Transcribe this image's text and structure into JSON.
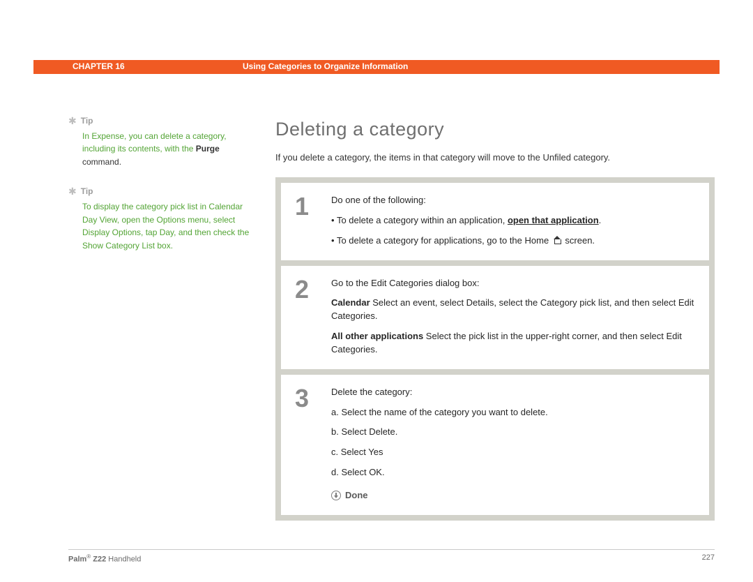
{
  "header": {
    "chapter_label": "CHAPTER 16",
    "topic": "Using Categories to Organize Information"
  },
  "sidebar": {
    "tips": [
      {
        "label": "Tip",
        "lines": [
          {
            "kind": "green",
            "text": "In Expense, you can delete a category, including its contents, with the "
          },
          {
            "kind": "black_bold",
            "text": "Purge"
          },
          {
            "kind": "black",
            "text": " command."
          }
        ]
      },
      {
        "label": "Tip",
        "lines": [
          {
            "kind": "green",
            "text": "To display the category pick list in Calendar Day View, open the Options menu, select Display Options, tap Day, and then check the Show Category List box."
          }
        ]
      }
    ]
  },
  "main": {
    "title": "Deleting a category",
    "intro": "If you delete a category, the items in that category will move to the Unfiled category.",
    "steps": [
      {
        "num": "1",
        "blocks": [
          {
            "type": "p",
            "text": "Do one of the following:"
          },
          {
            "type": "bullet",
            "parts": [
              {
                "kind": "plain",
                "text": "To delete a category within an application, "
              },
              {
                "kind": "bold_underline",
                "text": "open that application"
              },
              {
                "kind": "plain",
                "text": "."
              }
            ]
          },
          {
            "type": "bullet_home",
            "before": "To delete a category for applications, go to the Home ",
            "after": " screen."
          }
        ]
      },
      {
        "num": "2",
        "blocks": [
          {
            "type": "p",
            "text": "Go to the Edit Categories dialog box:"
          },
          {
            "type": "lead",
            "lead": "Calendar",
            "rest": "    Select an event, select Details, select the Category pick list, and then select Edit Categories."
          },
          {
            "type": "lead",
            "lead": "All other applications",
            "rest": "    Select the pick list in the upper-right corner, and then select Edit Categories."
          }
        ]
      },
      {
        "num": "3",
        "blocks": [
          {
            "type": "p",
            "text": "Delete the category:"
          },
          {
            "type": "p",
            "text": "a.  Select the name of the category you want to delete."
          },
          {
            "type": "p",
            "text": "b.  Select Delete."
          },
          {
            "type": "p",
            "text": "c.  Select Yes"
          },
          {
            "type": "p",
            "text": "d.  Select OK."
          },
          {
            "type": "done",
            "text": "Done"
          }
        ]
      }
    ]
  },
  "footer": {
    "brand_bold": "Palm",
    "brand_reg": "®",
    "brand_model": " Z22",
    "brand_suffix": " Handheld",
    "page_number": "227"
  }
}
